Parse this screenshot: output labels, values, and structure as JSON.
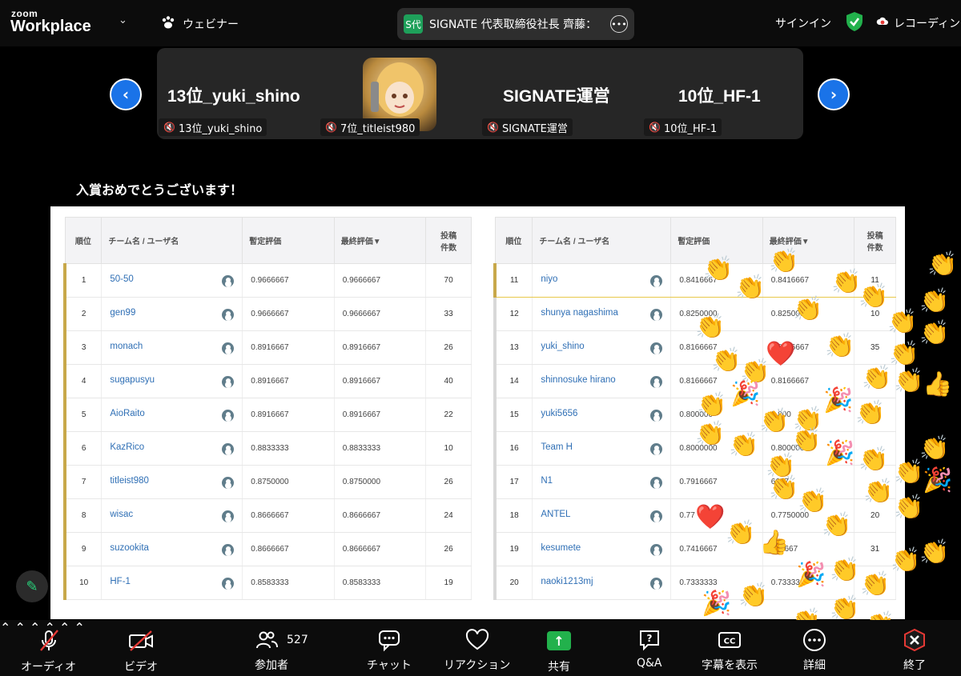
{
  "app": {
    "brand_top": "zoom",
    "brand_main": "Workplace",
    "mode": "ウェビナー"
  },
  "speaker": {
    "badge": "S代",
    "text": "SIGNATE 代表取締役社長 齊藤："
  },
  "header_right": {
    "signin": "サインイン",
    "recording": "レコーディング"
  },
  "gallery": {
    "tiles": [
      {
        "display_name": "13位_yuki_shino",
        "label": "13位_yuki_shino"
      },
      {
        "display_name": "",
        "label": "7位_titleist980"
      },
      {
        "display_name": "SIGNATE運営",
        "label": "SIGNATE運営"
      },
      {
        "display_name": "10位_HF-1",
        "label": "10位_HF-1"
      }
    ]
  },
  "share": {
    "heading": "入賞おめでとうございます！"
  },
  "leaderboard": {
    "headers": {
      "rank": "順位",
      "team": "チーム名 / ユーザ名",
      "provisional": "暫定評価",
      "final": "最終評価▼",
      "count_l1": "投稿",
      "count_l2": "件数"
    },
    "left": [
      {
        "rank": "1",
        "team": "50-50",
        "prov": "0.9666667",
        "final": "0.9666667",
        "count": "70"
      },
      {
        "rank": "2",
        "team": "gen99",
        "prov": "0.9666667",
        "final": "0.9666667",
        "count": "33"
      },
      {
        "rank": "3",
        "team": "monach",
        "prov": "0.8916667",
        "final": "0.8916667",
        "count": "26"
      },
      {
        "rank": "4",
        "team": "sugapusyu",
        "prov": "0.8916667",
        "final": "0.8916667",
        "count": "40"
      },
      {
        "rank": "5",
        "team": "AioRaito",
        "prov": "0.8916667",
        "final": "0.8916667",
        "count": "22"
      },
      {
        "rank": "6",
        "team": "KazRico",
        "prov": "0.8833333",
        "final": "0.8833333",
        "count": "10"
      },
      {
        "rank": "7",
        "team": "titleist980",
        "prov": "0.8750000",
        "final": "0.8750000",
        "count": "26"
      },
      {
        "rank": "8",
        "team": "wisac",
        "prov": "0.8666667",
        "final": "0.8666667",
        "count": "24"
      },
      {
        "rank": "9",
        "team": "suzookita",
        "prov": "0.8666667",
        "final": "0.8666667",
        "count": "26"
      },
      {
        "rank": "10",
        "team": "HF-1",
        "prov": "0.8583333",
        "final": "0.8583333",
        "count": "19"
      }
    ],
    "right": [
      {
        "rank": "11",
        "team": "niyo",
        "prov": "0.8416667",
        "final": "0.8416667",
        "count": "11"
      },
      {
        "rank": "12",
        "team": "shunya nagashima",
        "prov": "0.8250000",
        "final": "0.8250000",
        "count": "10"
      },
      {
        "rank": "13",
        "team": "yuki_shino",
        "prov": "0.8166667",
        "final": "0.8166667",
        "count": "35"
      },
      {
        "rank": "14",
        "team": "shinnosuke hirano",
        "prov": "0.8166667",
        "final": "0.8166667",
        "count": "6"
      },
      {
        "rank": "15",
        "team": "yuki5656",
        "prov": "0.800000",
        "final": "0.800",
        "count": ""
      },
      {
        "rank": "16",
        "team": "Team H",
        "prov": "0.8000000",
        "final": "0.800000",
        "count": ""
      },
      {
        "rank": "17",
        "team": "N1",
        "prov": "0.7916667",
        "final": "6667",
        "count": ""
      },
      {
        "rank": "18",
        "team": "ANTEL",
        "prov": "0.77",
        "final": "0.7750000",
        "count": "20"
      },
      {
        "rank": "19",
        "team": "kesumete",
        "prov": "0.7416667",
        "final": "416667",
        "count": "31"
      },
      {
        "rank": "20",
        "team": "naoki1213mj",
        "prov": "0.7333333",
        "final": "0.73333",
        "count": ""
      }
    ]
  },
  "toolbar": {
    "audio": "オーディオ",
    "video": "ビデオ",
    "participants": "参加者",
    "participants_count": "527",
    "chat": "チャット",
    "reactions": "リアクション",
    "share": "共有",
    "qa": "Q&A",
    "captions": "字幕を表示",
    "more": "詳細",
    "end": "終了"
  },
  "reaction_icons": [
    "clap-emoji",
    "heart-emoji",
    "party-popper-emoji",
    "thumbs-up-emoji"
  ]
}
